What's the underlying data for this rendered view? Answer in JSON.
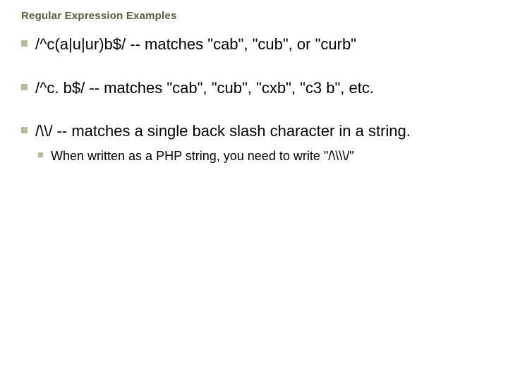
{
  "title": "Regular Expression Examples",
  "bullets": {
    "b0": "/^c(a|u|ur)b$/ -- matches \"cab\", \"cub\", or \"curb\"",
    "b1": "/^c. b$/ -- matches \"cab\", \"cub\", \"cxb\", \"c3 b\", etc.",
    "b2": "/\\\\/ -- matches a single back slash character in a string.",
    "b2_sub0": "When written as a PHP string, you need to write \"/\\\\\\\\/\""
  }
}
